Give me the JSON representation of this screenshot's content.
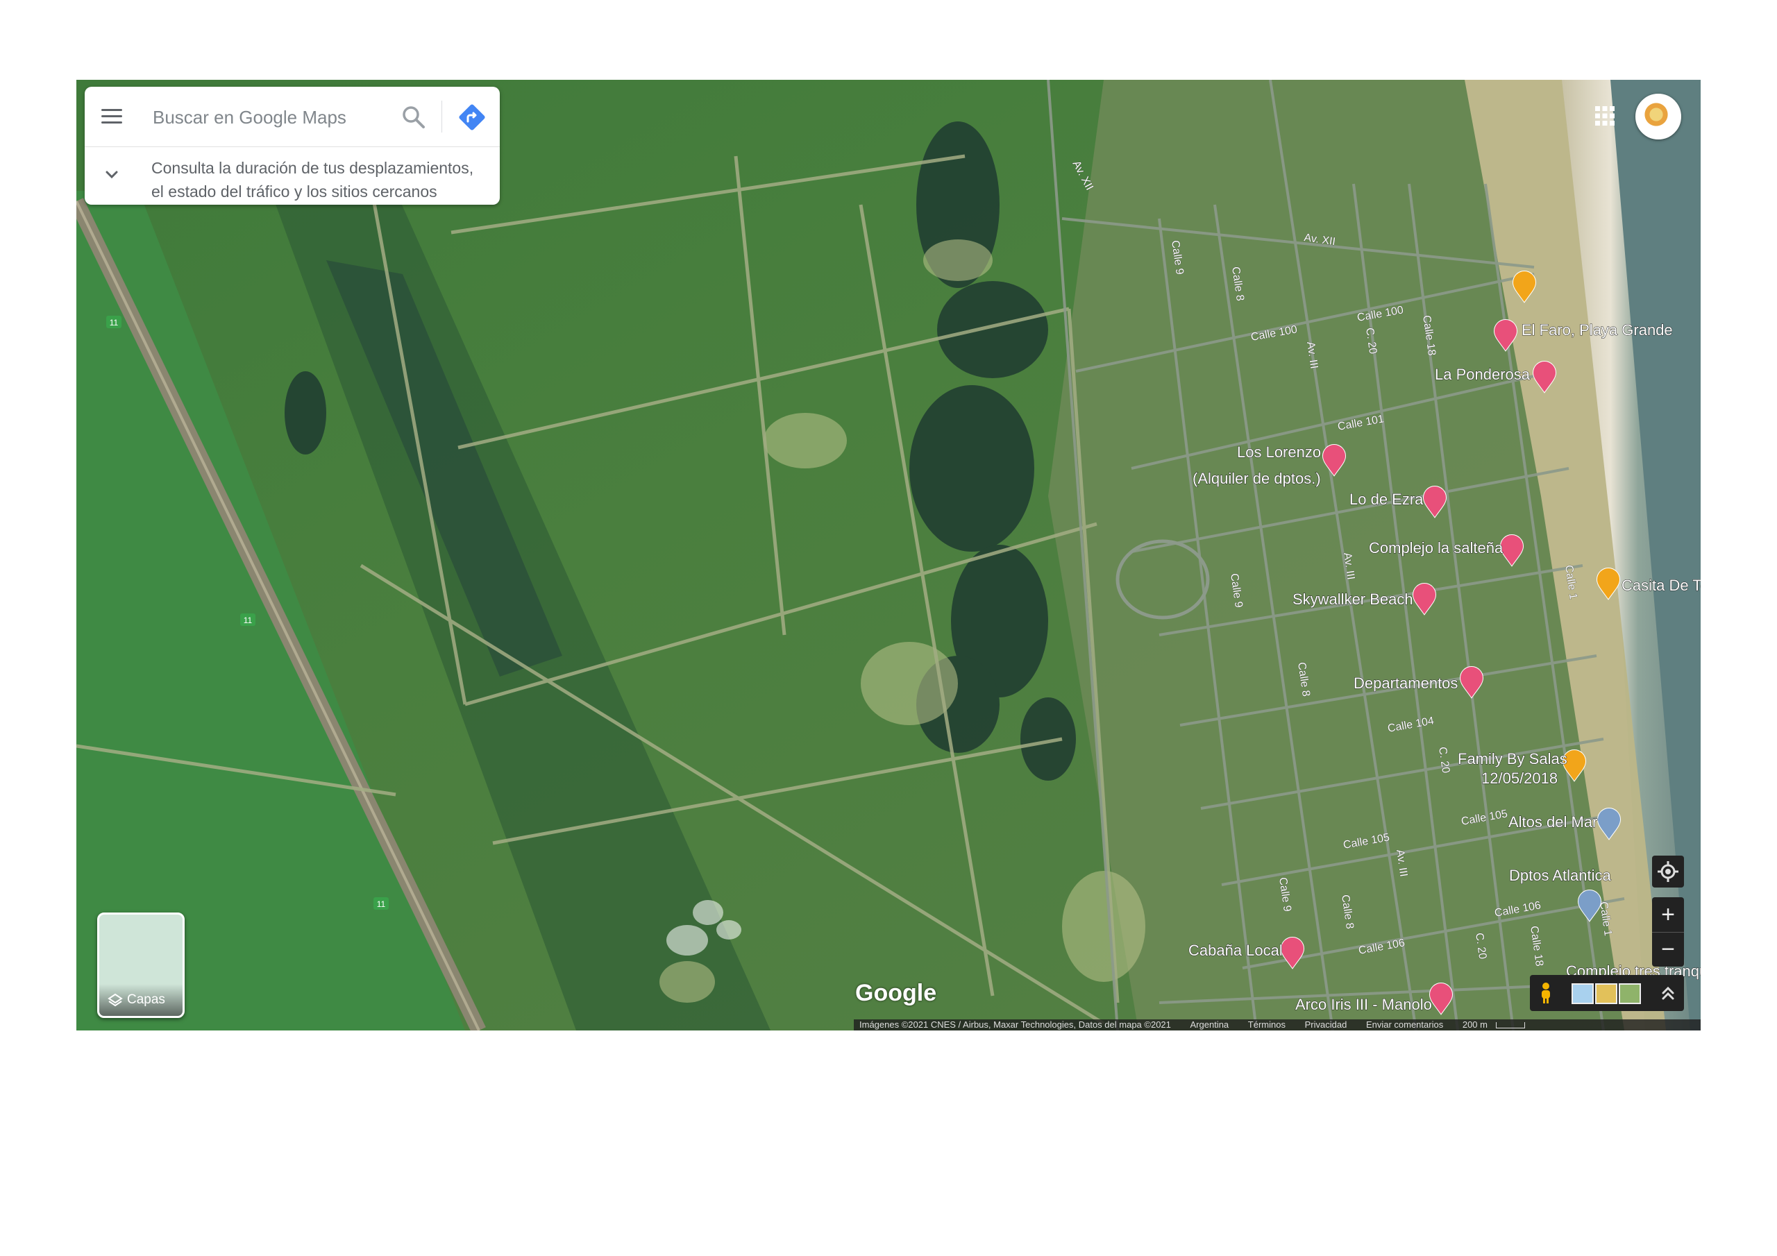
{
  "search": {
    "placeholder": "Buscar en Google Maps",
    "hint": "Consulta la duración de tus desplazamientos,\nel estado del tráfico y los sitios cercanos"
  },
  "layers": {
    "label": "Capas"
  },
  "brand": {
    "logo": "Google"
  },
  "footer": {
    "imagery": "Imágenes ©2021 CNES / Airbus, Maxar Technologies, Datos del mapa ©2021",
    "country": "Argentina",
    "terms": "Términos",
    "privacy": "Privacidad",
    "feedback": "Enviar comentarios",
    "scale": "200 m"
  },
  "controls": {
    "zoom_in": "+",
    "zoom_out": "−"
  },
  "colors": {
    "hotel_pin": "#e8507a",
    "food_pin": "#f2a51a",
    "place_pin": "#7b9ec8",
    "direction_blue": "#4285f4"
  },
  "highway": {
    "number": "11"
  },
  "street_labels": [
    "Av. XII",
    "Av. XII",
    "Calle 9",
    "Calle 8",
    "Calle 100",
    "Calle 100",
    "Av. III",
    "C. 20",
    "Calle 18",
    "Calle 101",
    "Av. III",
    "Calle 9",
    "Calle 1",
    "Calle 8",
    "Calle 104",
    "C. 20",
    "Calle 105",
    "Calle 105",
    "Av. III",
    "Calle 9",
    "Calle 8",
    "Calle 106",
    "Calle 106",
    "C. 20",
    "Calle 18",
    "Calle 1"
  ],
  "places": [
    {
      "name": "El Faro, Playa Grande",
      "type": "hotel"
    },
    {
      "name": "La Ponderosa",
      "type": "hotel"
    },
    {
      "name": "Los Lorenzo\n(Alquiler de dptos.)",
      "type": "hotel"
    },
    {
      "name": "Lo de Ezra",
      "type": "hotel"
    },
    {
      "name": "Complejo la salteña",
      "type": "hotel"
    },
    {
      "name": "Skywallker Beach",
      "type": "hotel"
    },
    {
      "name": "Casita De Te",
      "type": "food"
    },
    {
      "name": "Departamentos",
      "type": "hotel"
    },
    {
      "name": "Family By Salas\n12/05/2018",
      "type": "food"
    },
    {
      "name": "Altos del Mar",
      "type": "place"
    },
    {
      "name": "Dptos Atlantica",
      "type": "place"
    },
    {
      "name": "Cabaña Local",
      "type": "hotel"
    },
    {
      "name": "Arco Iris III - Manolo",
      "type": "hotel"
    },
    {
      "name": "Complejo tres tranqu",
      "type": "hotel"
    }
  ],
  "unlabeled_food_pin": {
    "type": "food"
  }
}
